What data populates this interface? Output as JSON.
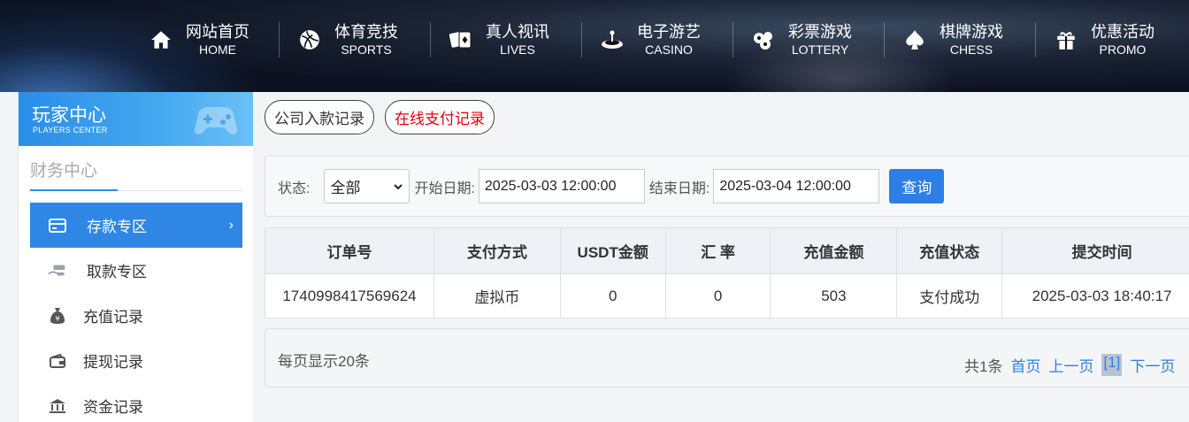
{
  "nav": [
    {
      "cn": "网站首页",
      "en": "HOME",
      "icon": "home-icon"
    },
    {
      "cn": "体育竞技",
      "en": "SPORTS",
      "icon": "ball-icon"
    },
    {
      "cn": "真人视讯",
      "en": "LIVES",
      "icon": "cards-icon"
    },
    {
      "cn": "电子游艺",
      "en": "CASINO",
      "icon": "roulette-icon"
    },
    {
      "cn": "彩票游戏",
      "en": "LOTTERY",
      "icon": "lottery-balls-icon"
    },
    {
      "cn": "棋牌游戏",
      "en": "CHESS",
      "icon": "spade-icon"
    },
    {
      "cn": "优惠活动",
      "en": "PROMO",
      "icon": "gift-icon"
    }
  ],
  "sidebar": {
    "title": "玩家中心",
    "subtitle": "PLAYERS CENTER",
    "section": "财务中心",
    "items": [
      {
        "label": "存款专区",
        "icon": "card-icon",
        "active": true
      },
      {
        "label": "取款专区",
        "icon": "cash-hand-icon"
      },
      {
        "label": "充值记录",
        "icon": "money-bag-icon"
      },
      {
        "label": "提现记录",
        "icon": "wallet-icon"
      },
      {
        "label": "资金记录",
        "icon": "bank-icon"
      }
    ],
    "arrow": "›"
  },
  "tabs": [
    "公司入款记录",
    "在线支付记录"
  ],
  "filter": {
    "status_label": "状态:",
    "status_value": "全部",
    "start_label": "开始日期:",
    "start_value": "2025-03-03 12:00:00",
    "end_label": "结束日期:",
    "end_value": "2025-03-04 12:00:00",
    "query": "查询"
  },
  "table": {
    "headers": [
      "订单号",
      "支付方式",
      "USDT金额",
      "汇 率",
      "充值金额",
      "充值状态",
      "提交时间"
    ],
    "rows": [
      [
        "1740998417569624",
        "虚拟币",
        "0",
        "0",
        "503",
        "支付成功",
        "2025-03-03 18:40:17"
      ]
    ]
  },
  "pager": {
    "per_page": "每页显示20条",
    "total": "共1条",
    "first": "首页",
    "prev": "上一页",
    "current": "[1]",
    "next": "下一页"
  },
  "colors": {
    "accent": "#2f86e5",
    "danger": "#e60012"
  }
}
